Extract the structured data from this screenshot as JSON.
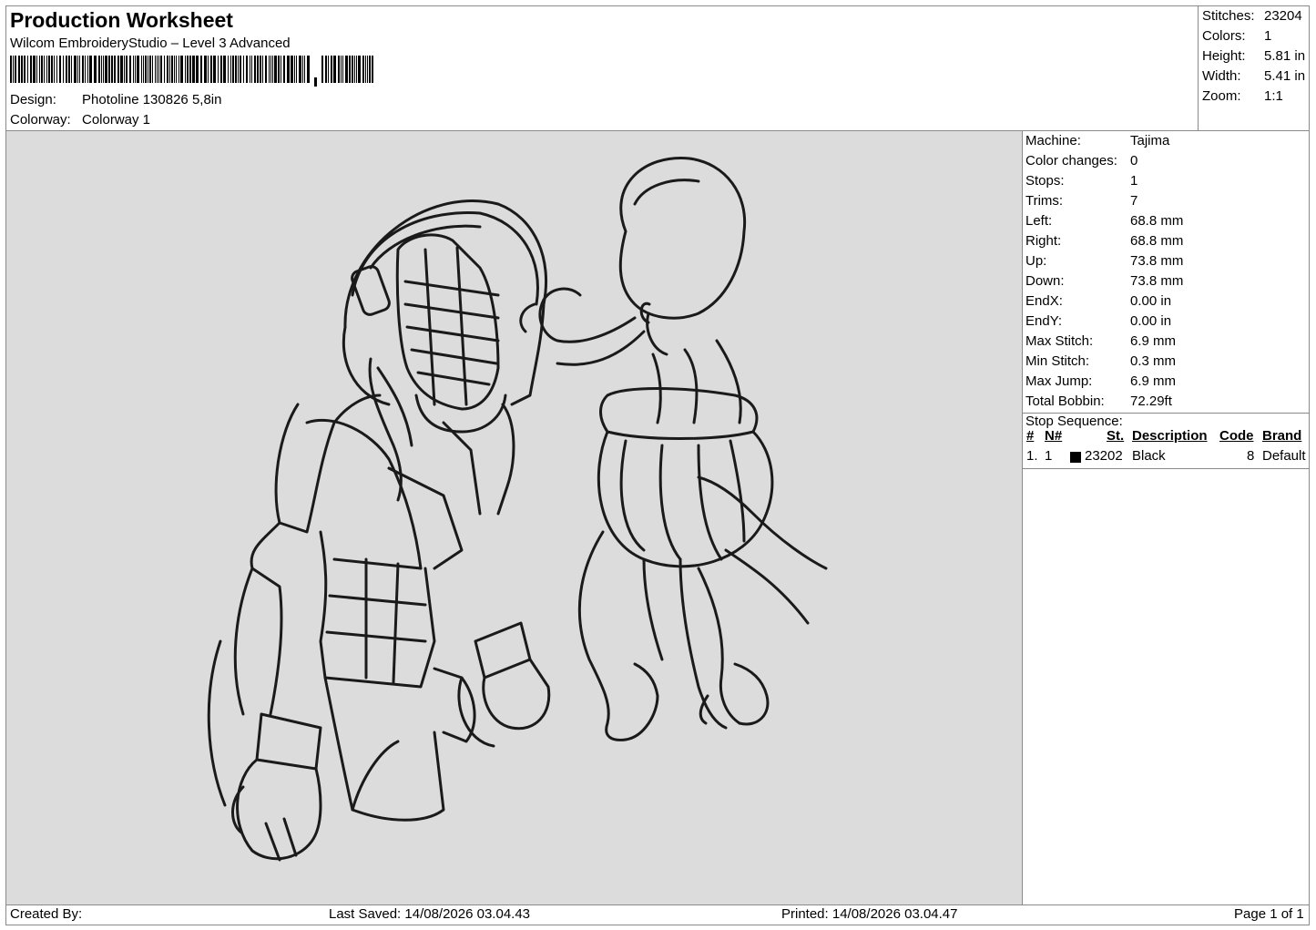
{
  "header": {
    "title": "Production Worksheet",
    "subtitle": "Wilcom EmbroideryStudio – Level 3 Advanced",
    "design_label": "Design:",
    "design_value": "Photoline 130826 5,8in",
    "colorway_label": "Colorway:",
    "colorway_value": "Colorway 1"
  },
  "summary": [
    {
      "label": "Stitches:",
      "value": "23204"
    },
    {
      "label": "Colors:",
      "value": "1"
    },
    {
      "label": "Height:",
      "value": "5.81 in"
    },
    {
      "label": "Width:",
      "value": "5.41 in"
    },
    {
      "label": "Zoom:",
      "value": "1:1"
    }
  ],
  "machine_info": [
    {
      "label": "Machine:",
      "value": "Tajima"
    },
    {
      "label": "Color changes:",
      "value": "0"
    },
    {
      "label": "Stops:",
      "value": "1"
    },
    {
      "label": "Trims:",
      "value": "7"
    },
    {
      "label": "Left:",
      "value": "68.8 mm"
    },
    {
      "label": "Right:",
      "value": "68.8 mm"
    },
    {
      "label": "Up:",
      "value": "73.8 mm"
    },
    {
      "label": "Down:",
      "value": "73.8 mm"
    },
    {
      "label": "EndX:",
      "value": "0.00 in"
    },
    {
      "label": "EndY:",
      "value": "0.00 in"
    },
    {
      "label": "Max Stitch:",
      "value": "6.9 mm"
    },
    {
      "label": "Min Stitch:",
      "value": "0.3 mm"
    },
    {
      "label": "Max Jump:",
      "value": "6.9 mm"
    },
    {
      "label": "Total Bobbin:",
      "value": "72.29ft"
    }
  ],
  "stop_sequence": {
    "title": "Stop Sequence:",
    "columns": [
      "#",
      "N#",
      "St.",
      "Description",
      "Code",
      "Brand"
    ],
    "rows": [
      {
        "index": "1.",
        "n": "1",
        "stitches": "23202",
        "description": "Black",
        "code": "8",
        "brand": "Default",
        "color": "#000000"
      }
    ]
  },
  "footer": {
    "created_by": "Created By:",
    "last_saved": "Last Saved: 14/08/2026 03.04.43",
    "printed": "Printed: 14/08/2026 03.04.47",
    "page": "Page 1 of 1"
  },
  "colors": {
    "canvas_bg": "#dcdcdc",
    "thread": "#1a1a1a"
  }
}
